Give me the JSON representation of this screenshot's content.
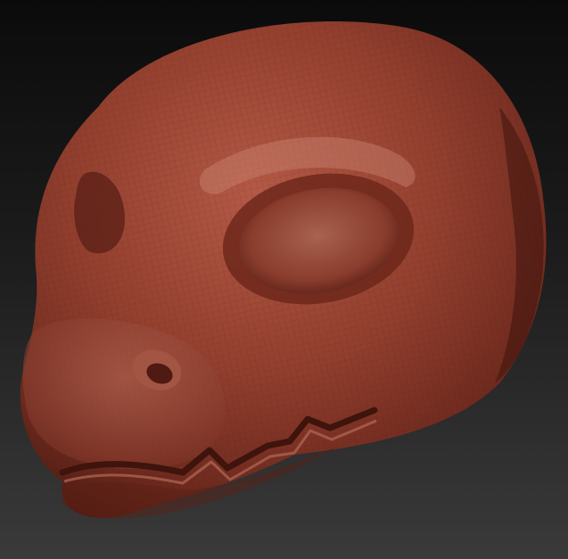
{
  "viewport": {
    "background_top": "#0b0b0b",
    "background_bottom": "#3a3a3a"
  },
  "model": {
    "material_color": "#8e3a2a",
    "highlight_color": "#c27a68",
    "shadow_color": "#4a1a12",
    "subject": "sculpted-creature-head"
  }
}
